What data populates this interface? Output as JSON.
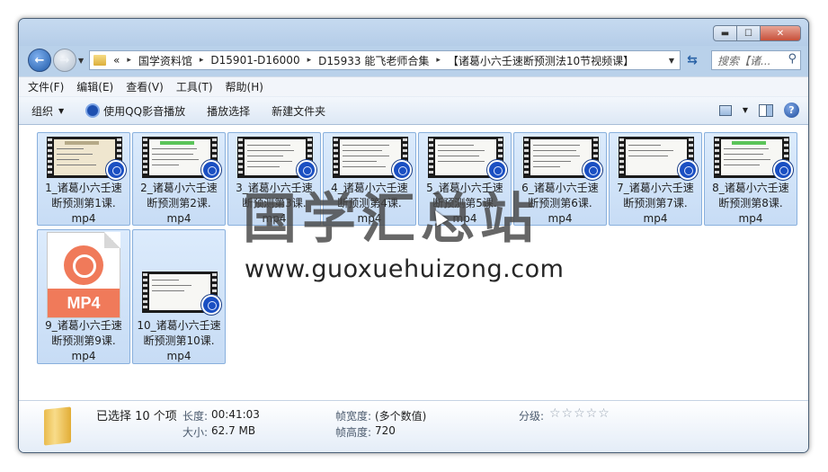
{
  "window": {
    "minimize_glyph": "▬",
    "maximize_glyph": "☐",
    "close_glyph": "✕"
  },
  "address": {
    "overflow": "«",
    "crumbs": [
      "国学资料馆",
      "D15901-D16000",
      "D15933 能飞老师合集",
      "【诸葛小六壬速断预测法10节视频课】"
    ],
    "separator": "▸",
    "dropdown_glyph": "▼",
    "refresh_glyph": "⇆"
  },
  "search": {
    "placeholder": "搜索【诸...",
    "icon": "search-icon"
  },
  "menu": [
    "文件(F)",
    "编辑(E)",
    "查看(V)",
    "工具(T)",
    "帮助(H)"
  ],
  "toolbar": {
    "organize": "组织",
    "play_qq": "使用QQ影音播放",
    "play_select": "播放选择",
    "new_folder": "新建文件夹",
    "help_glyph": "?"
  },
  "files": [
    {
      "name": "1_诸葛小六壬速断预测第1课.mp4",
      "line1": "1_诸葛小六壬速",
      "line2": "断预测第1课.",
      "line3": "mp4",
      "selected": true
    },
    {
      "name": "2_诸葛小六壬速断预测第2课.mp4",
      "line1": "2_诸葛小六壬速",
      "line2": "断预测第2课.",
      "line3": "mp4",
      "selected": true
    },
    {
      "name": "3_诸葛小六壬速断预测第3课.mp4",
      "line1": "3_诸葛小六壬速",
      "line2": "断预测第3课.",
      "line3": "mp4",
      "selected": true
    },
    {
      "name": "4_诸葛小六壬速断预测第4课.mp4",
      "line1": "4_诸葛小六壬速",
      "line2": "断预测第4课.",
      "line3": "mp4",
      "selected": true
    },
    {
      "name": "5_诸葛小六壬速断预测第5课.mp4",
      "line1": "5_诸葛小六壬速",
      "line2": "断预测第5课.",
      "line3": "mp4",
      "selected": true
    },
    {
      "name": "6_诸葛小六壬速断预测第6课.mp4",
      "line1": "6_诸葛小六壬速",
      "line2": "断预测第6课.",
      "line3": "mp4",
      "selected": true
    },
    {
      "name": "7_诸葛小六壬速断预测第7课.mp4",
      "line1": "7_诸葛小六壬速",
      "line2": "断预测第7课.",
      "line3": "mp4",
      "selected": true
    },
    {
      "name": "8_诸葛小六壬速断预测第8课.mp4",
      "line1": "8_诸葛小六壬速",
      "line2": "断预测第8课.",
      "line3": "mp4",
      "selected": true
    },
    {
      "name": "9_诸葛小六壬速断预测第9课.mp4",
      "line1": "9_诸葛小六壬速",
      "line2": "断预测第9课.",
      "line3": "mp4",
      "selected": true,
      "generic_icon_text": "MP4"
    },
    {
      "name": "10_诸葛小六壬速断预测第10课.mp4",
      "line1": "10_诸葛小六壬速",
      "line2": "断预测第10课.",
      "line3": "mp4",
      "selected": true
    }
  ],
  "watermark": {
    "cn": "国学汇总站",
    "url": "www.guoxuehuizong.com"
  },
  "details": {
    "selected": "已选择 10 个项",
    "length_label": "长度:",
    "length_value": "00:41:03",
    "size_label": "大小:",
    "size_value": "62.7 MB",
    "width_label": "帧宽度:",
    "width_value": "(多个数值)",
    "height_label": "帧高度:",
    "height_value": "720",
    "rating_label": "分级:",
    "rating_stars": "☆☆☆☆☆",
    "rating": 0
  },
  "colors": {
    "selection": "#cde1f8",
    "frame": "#b9d1ea",
    "badge": "#1a4fc2",
    "mp4_icon": "#f07a5a"
  }
}
